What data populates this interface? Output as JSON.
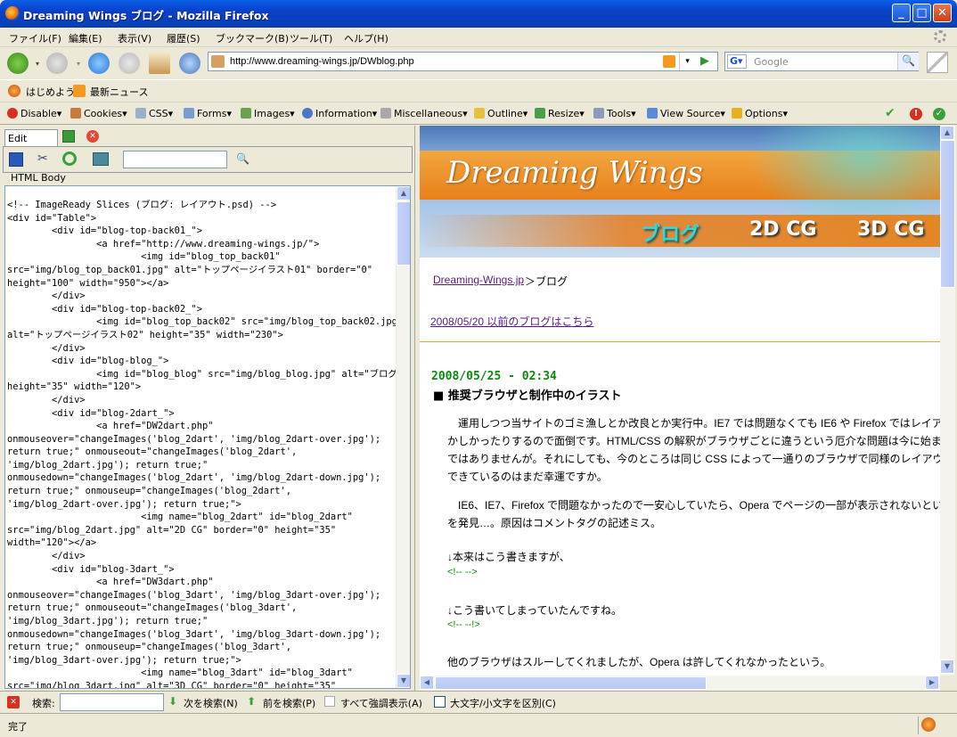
{
  "window": {
    "title": "Dreaming Wings ブログ - Mozilla Firefox",
    "minimize": "_",
    "maximize": "□",
    "close": "✕"
  },
  "menu": [
    "ファイル(F)",
    "編集(E)",
    "表示(V)",
    "履歴(S)",
    "ブックマーク(B)",
    "ツール(T)",
    "ヘルプ(H)"
  ],
  "nav": {
    "url": "http://www.dreaming-wings.jp/DWblog.php",
    "search_placeholder": "Google"
  },
  "bookmarks": [
    "はじめよう",
    "最新ニュース"
  ],
  "webdev": [
    "Disable▾",
    "Cookies▾",
    "CSS▾",
    "Forms▾",
    "Images▾",
    "Information▾",
    "Miscellaneous▾",
    "Outline▾",
    "Resize▾",
    "Tools▾",
    "View Source▾",
    "Options▾"
  ],
  "editor": {
    "tab": "Edit HTML",
    "breadcrumb": "HTML Body",
    "code": "<!-- ImageReady Slices (ブログ: レイアウト.psd) -->\n<div id=\"Table\">\n        <div id=\"blog-top-back01_\">\n                <a href=\"http://www.dreaming-wings.jp/\">\n                        <img id=\"blog_top_back01\"\nsrc=\"img/blog_top_back01.jpg\" alt=\"トップページイラスト01\" border=\"0\"\nheight=\"100\" width=\"950\"></a>\n        </div>\n        <div id=\"blog-top-back02_\">\n                <img id=\"blog_top_back02\" src=\"img/blog_top_back02.jpg\"\nalt=\"トップページイラスト02\" height=\"35\" width=\"230\">\n        </div>\n        <div id=\"blog-blog_\">\n                <img id=\"blog_blog\" src=\"img/blog_blog.jpg\" alt=\"ブログ\"\nheight=\"35\" width=\"120\">\n        </div>\n        <div id=\"blog-2dart_\">\n                <a href=\"DW2dart.php\"\nonmouseover=\"changeImages('blog_2dart', 'img/blog_2dart-over.jpg');\nreturn true;\" onmouseout=\"changeImages('blog_2dart',\n'img/blog_2dart.jpg'); return true;\"\nonmousedown=\"changeImages('blog_2dart', 'img/blog_2dart-down.jpg');\nreturn true;\" onmouseup=\"changeImages('blog_2dart',\n'img/blog_2dart-over.jpg'); return true;\">\n                        <img name=\"blog_2dart\" id=\"blog_2dart\"\nsrc=\"img/blog_2dart.jpg\" alt=\"2D CG\" border=\"0\" height=\"35\"\nwidth=\"120\"></a>\n        </div>\n        <div id=\"blog-3dart_\">\n                <a href=\"DW3dart.php\"\nonmouseover=\"changeImages('blog_3dart', 'img/blog_3dart-over.jpg');\nreturn true;\" onmouseout=\"changeImages('blog_3dart',\n'img/blog_3dart.jpg'); return true;\"\nonmousedown=\"changeImages('blog_3dart', 'img/blog_3dart-down.jpg');\nreturn true;\" onmouseup=\"changeImages('blog_3dart',\n'img/blog_3dart-over.jpg'); return true;\">\n                        <img name=\"blog_3dart\" id=\"blog_3dart\"\nsrc=\"img/blog_3dart.jpg\" alt=\"3D CG\" border=\"0\" height=\"35\""
  },
  "page": {
    "logo": "Dreaming Wings",
    "nav_blog": "ブログ",
    "nav_2d": "2D CG",
    "nav_3d": "3D CG",
    "breadcrumb_link": "Dreaming-Wings.jp",
    "breadcrumb_rest": "＞ブログ",
    "archive_link": "2008/05/20 以前のブログはこちら",
    "post_date": "2008/05/25 - 02:34",
    "post_title": "■ 推奨ブラウザと制作中のイラスト",
    "p1": [
      "　運用しつつ当サイトのゴミ漁しとか改良とか実行中。IE7 では問題なくても IE6 や Firefox ではレイア",
      "かしかったりするので面倒です。HTML/CSS の解釈がブラウザごとに違うという厄介な問題は今に始ま",
      "ではありませんが。それにしても、今のところは同じ CSS によって一通りのブラウザで同様のレイアウト",
      "できているのはまだ幸運ですか。"
    ],
    "p2": [
      "　IE6、IE7、Firefox で問題なかったので一安心していたら、Opera でページの一部が表示されないとい",
      "を発見…。原因はコメントタグの記述ミス。"
    ],
    "l1": "↓本来はこう書きますが、",
    "c1": "<!-- -->",
    "l2": "↓こう書いてしまっていたんですね。",
    "c2": "<!-- --!>",
    "l3": "他のブラウザはスルーしてくれましたが、Opera は許してくれなかったという。"
  },
  "findbar": {
    "label": "検索:",
    "next": "次を検索(N)",
    "prev": "前を検索(P)",
    "highlight": "すべて強調表示(A)",
    "matchcase": "大文字/小文字を区別(C)"
  },
  "status": "完了"
}
